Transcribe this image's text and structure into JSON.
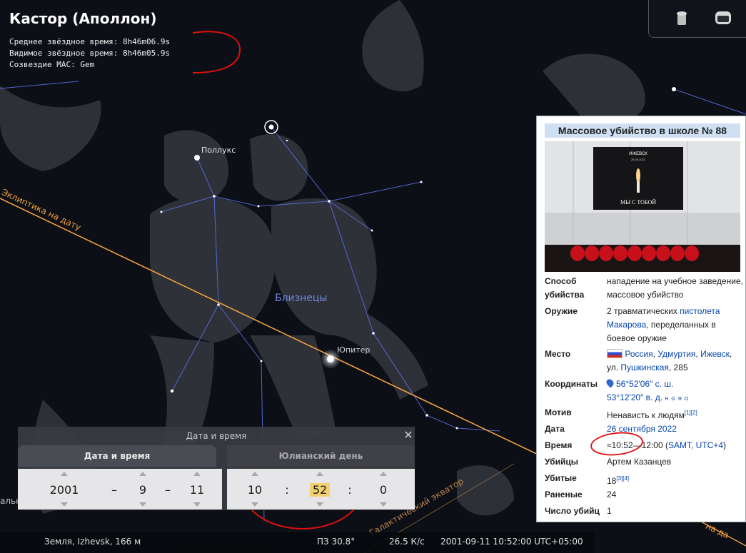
{
  "object": {
    "name": "Кастор (Аполлон)",
    "sidereal_mean": "Среднее звёздное время: 8h46m06.9s",
    "sidereal_apparent": "Видимое звёздное время: 8h46m05.9s",
    "constellation": "Созвездие МАС: Gem"
  },
  "sky": {
    "pollux": "Поллукс",
    "gemini": "Близнецы",
    "jupiter": "Юпитер",
    "ecliptic": "Эклиптика на дату",
    "equator": "Галактический экватор",
    "edge_label": "альный Пес",
    "edge_label_right": "на да",
    "colors": {
      "ecliptic": "#f0a040",
      "lines": "#5a6ee0",
      "annotation": "#e01010",
      "constellation_name": "#6f8ae0"
    }
  },
  "toolbar": {
    "icons": [
      "trash-icon",
      "window-icon"
    ]
  },
  "wiki": {
    "title": "Массовое убийство в школе № 88",
    "photo": {
      "sign_top": "ИЖЕВСК",
      "sign_date": "26.09.2022",
      "sign_bottom": "МЫ С ТОБОЙ"
    },
    "rows": [
      {
        "key": "Способ убийства",
        "value": "нападение на учебное заведение, массовое убийство"
      },
      {
        "key": "Оружие",
        "value_a": "2 травматических ",
        "value_link": "пистолета Макарова",
        "value_b": ", переделанных в боевое оружие"
      },
      {
        "key": "Место",
        "link1": "Россия",
        "link2": "Удмуртия",
        "link3": "Ижевск",
        "plain": "ул. ",
        "link4": "Пушкинская",
        "plain2": ", 285"
      },
      {
        "key": "Координаты",
        "link1": "56°52′06″ с. ш.",
        "link2": "53°12′20″ в. д.",
        "tiny": "H G Я O"
      },
      {
        "key": "Мотив",
        "value": "Ненависть к людям",
        "refs": "[1][2]"
      },
      {
        "key": "Дата",
        "value": "26 сентября 2022"
      },
      {
        "key": "Время",
        "value": "≈10:52—12:00 (",
        "link": "SAMT, UTC+4",
        "end": ")"
      },
      {
        "key": "Убийцы",
        "value": "Артем Казанцев"
      },
      {
        "key": "Убитые",
        "value": "18",
        "refs": "[3][4]"
      },
      {
        "key": "Раненые",
        "value": "24"
      },
      {
        "key": "Число убийц",
        "value": "1"
      }
    ]
  },
  "dialog": {
    "title": "Дата и время",
    "tab_date": "Дата и время",
    "tab_jd": "Юлианский день",
    "year": "2001",
    "month": "9",
    "day": "11",
    "hour": "10",
    "minute": "52",
    "second": "0",
    "sep_dash": "–",
    "sep_colon": ":",
    "close": "✕"
  },
  "status": {
    "location": "Земля, Izhevsk, 166 м",
    "fov": "ПЗ 30.8°",
    "fps": "26.5 К/с",
    "datetime": "2001-09-11 10:52:00 UTC+05:00"
  }
}
